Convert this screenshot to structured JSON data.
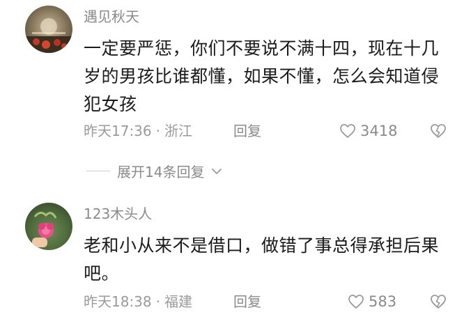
{
  "comments": [
    {
      "nickname": "遇见秋天",
      "content": "一定要严惩，你们不要说不满十四，现在十几岁的男孩比谁都懂，如果不懂，怎么会知道侵犯女孩",
      "time": "昨天17:36",
      "separator": "·",
      "location": "浙江",
      "reply_label": "回复",
      "likes": "3418",
      "avatar_icon": "sunset-flowers-avatar"
    },
    {
      "nickname": "123木头人",
      "content": "老和小从来不是借口，做错了事总得承担后果吧。",
      "time": "昨天18:38",
      "separator": "·",
      "location": "福建",
      "reply_label": "回复",
      "likes": "583",
      "avatar_icon": "pink-flower-avatar"
    }
  ],
  "expand_replies": {
    "label": "展开14条回复"
  },
  "icons": {
    "like": "heart-icon",
    "dislike": "broken-heart-icon",
    "expand": "chevron-down-icon"
  }
}
